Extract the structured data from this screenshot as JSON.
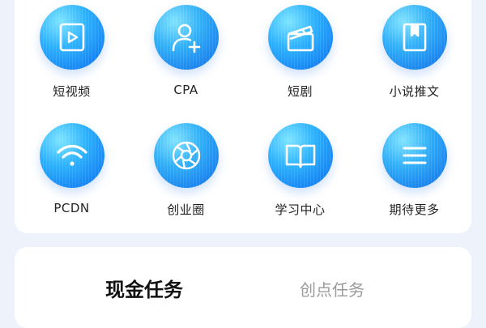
{
  "grid": {
    "items": [
      {
        "label": "短视频",
        "icon": "video-icon"
      },
      {
        "label": "CPA",
        "icon": "user-add-icon"
      },
      {
        "label": "短剧",
        "icon": "clapperboard-icon"
      },
      {
        "label": "小说推文",
        "icon": "book-icon"
      },
      {
        "label": "PCDN",
        "icon": "wifi-icon"
      },
      {
        "label": "创业圈",
        "icon": "aperture-icon"
      },
      {
        "label": "学习中心",
        "icon": "open-book-icon"
      },
      {
        "label": "期待更多",
        "icon": "menu-icon"
      }
    ]
  },
  "tabs": [
    {
      "label": "现金任务",
      "active": true
    },
    {
      "label": "创点任务",
      "active": false
    }
  ],
  "colors": {
    "accent": "#1a88f2",
    "background": "#eef2fa",
    "inactive_tab": "#9a9a9a"
  }
}
